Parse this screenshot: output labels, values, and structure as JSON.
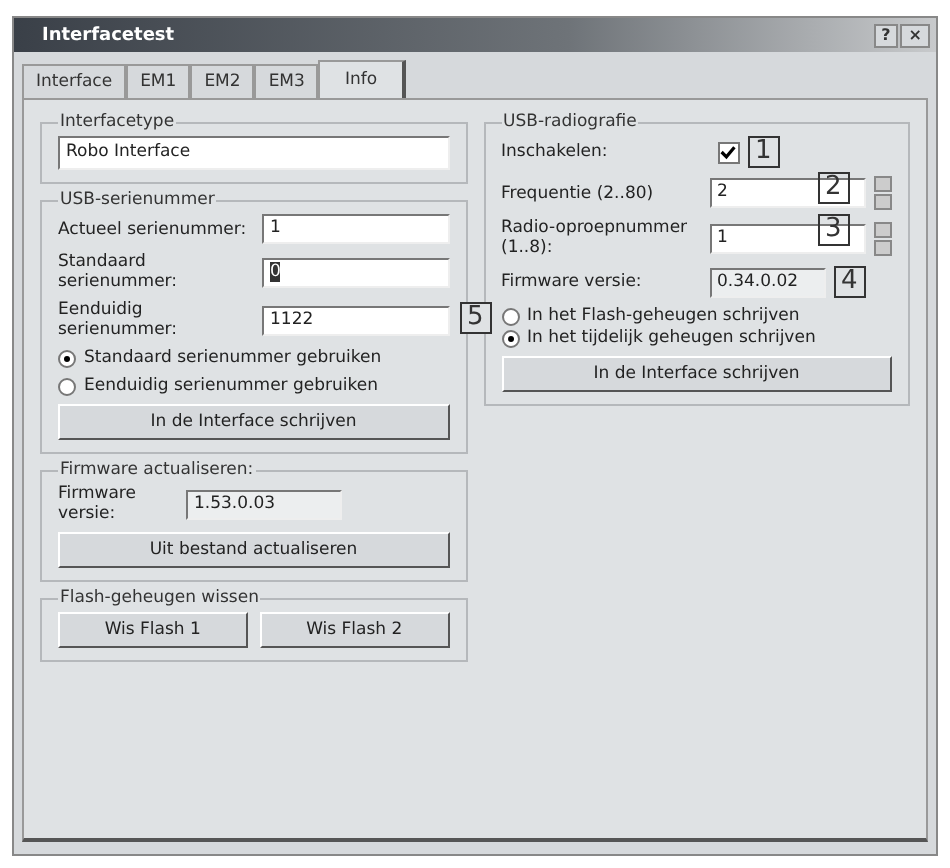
{
  "window": {
    "title": "Interfacetest",
    "help_button": "?",
    "close_button": "×"
  },
  "tabs": [
    {
      "label": "Interface",
      "selected": false
    },
    {
      "label": "EM1",
      "selected": false
    },
    {
      "label": "EM2",
      "selected": false
    },
    {
      "label": "EM3",
      "selected": false
    },
    {
      "label": "Info",
      "selected": true
    }
  ],
  "interface_type": {
    "title": "Interfacetype",
    "value": "Robo Interface"
  },
  "serial": {
    "title": "USB-serienummer",
    "fields": [
      {
        "label": "Actueel serienummer:",
        "value": "1",
        "highlighted": false
      },
      {
        "label": "Standaard serienummer:",
        "value": "0",
        "highlighted": true
      },
      {
        "label": "Eenduidig serienummer:",
        "value": "1122",
        "highlighted": false
      }
    ],
    "options": [
      {
        "label": "Standaard serienummer gebruiken",
        "selected": true
      },
      {
        "label": "Eenduidig serienummer gebruiken",
        "selected": false
      }
    ],
    "button": "In de Interface schrijven"
  },
  "firmware": {
    "title": "Firmware actualiseren:",
    "label": "Firmware versie:",
    "value": "1.53.0.03",
    "button": "Uit bestand actualiseren"
  },
  "flash": {
    "title": "Flash-geheugen wissen",
    "buttons": [
      "Wis Flash 1",
      "Wis Flash 2"
    ]
  },
  "radio": {
    "title": "USB-radiografie",
    "enable": {
      "label": "Inschakelen:",
      "checked": true,
      "callout": "1"
    },
    "fields": [
      {
        "kind": "spin",
        "label": "Frequentie (2..80)",
        "value": "2",
        "callout": "2"
      },
      {
        "kind": "spin",
        "label": "Radio-oproepnummer (1..8):",
        "value": "1",
        "callout": "3"
      },
      {
        "kind": "readonly",
        "label": "Firmware versie:",
        "value": "0.34.0.02",
        "callout": "4"
      }
    ],
    "options_callout": "5",
    "options": [
      {
        "label": "In het Flash-geheugen schrijven",
        "selected": false
      },
      {
        "label": "In het tijdelijk geheugen schrijven",
        "selected": true
      }
    ],
    "button": "In de Interface schrijven"
  }
}
